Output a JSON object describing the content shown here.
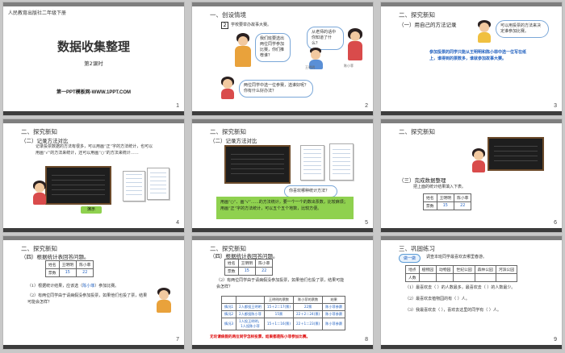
{
  "slides": [
    {
      "number": "1",
      "header": "人民教育出版社二年级下册",
      "title": "数据收集整理",
      "subtitle": "第2课时",
      "site": "第一PPT模板网-WWW.1PPT.COM"
    },
    {
      "number": "2",
      "section": "一、创设情境",
      "badge": "2",
      "caption": "学校要举办故事大赛。",
      "teacher_bubble": "我们班要选出两位同学参加比赛，你们推荐谁？",
      "girl_bubble": "从老师的话中你知道了什么？",
      "name_left": "王明明",
      "name_right": "陈小菲",
      "question_bubble": "两位同学中选一位参赛，选谁好呢？你有什么好办法？"
    },
    {
      "number": "3",
      "section": "二、探究新知",
      "sub": "（一）用自己的方法记录",
      "bubble": "可以用投票的方法来决定谁参加比赛。",
      "body": "参加投票的同学只能从王明明和陈小菲中选一位写在纸上，谁得到的票数多，谁就参加故事大赛。"
    },
    {
      "number": "4",
      "section": "二、探究新知",
      "sub": "（二）记录方法对比",
      "body": "记录投票数据的方法有很多，可以用画“正”字的方法统计，也可以用画“√”的方法来统计，还可以用画“○”的方法来统计……",
      "girl_bubble": "选票：",
      "button_label": "演示"
    },
    {
      "number": "5",
      "section": "二、探究新知",
      "sub": "（二）记录方法对比",
      "bubble": "你喜欢哪种统计方法？",
      "green": "用画“○”、画“√”……的方法统计，要一个一个的数出票数，比较麻烦；用画“正”字的方法统计，可以五个五个地数，比较方便。"
    },
    {
      "number": "6",
      "section": "二、探究新知",
      "sub": "（三）完成数据整理",
      "body": "把上面的统计结果填入下表。",
      "table_headers": [
        "姓名",
        "王明明",
        "陈小菲"
      ],
      "table_row_label": "票数",
      "table_values": [
        "15",
        "22"
      ]
    },
    {
      "number": "7",
      "section": "二、探究新知",
      "sub": "（四）根据统计表回答问题。",
      "table_headers": [
        "姓名",
        "王明明",
        "陈小菲"
      ],
      "table_row_label": "票数",
      "table_values": [
        "15",
        "22"
      ],
      "q1_prefix": "（1）根据统计结果，应该选（",
      "q1_answer": "陈小菲",
      "q1_suffix": "）参加比赛。",
      "q2": "（2）有两位同学由于请病假没参加投票，如果他们也投了票，结果可能会怎样？"
    },
    {
      "number": "8",
      "section": "二、探究新知",
      "sub": "（四）根据统计表回答问题。",
      "table_headers": [
        "姓名",
        "王明明",
        "陈小菲"
      ],
      "table_row_label": "票数",
      "table_values": [
        "15",
        "22"
      ],
      "q": "（2）有两位同学由于请病假没参加投票，如果他们也投了票，结果可能会怎样？",
      "case_headers": [
        "",
        "",
        "王明明的票数",
        "陈小菲的票数",
        "结果"
      ],
      "cases": [
        [
          "情况1",
          "2人都投王明明",
          "15＋2＝17(票)",
          "22票",
          "陈小菲参赛"
        ],
        [
          "情况2",
          "2人都投陈小菲",
          "15票",
          "22＋2＝24(票)",
          "陈小菲参赛"
        ],
        [
          "情况3",
          "1人投王明明，1人投陈小菲",
          "15＋1＝16(票)",
          "22＋1＝23(票)",
          "陈小菲参赛"
        ]
      ],
      "conclusion": "无论请病假的两位同学怎样投票，结果都是陈小菲参加比赛。"
    },
    {
      "number": "9",
      "section": "三、巩固练习",
      "tag": "做一做",
      "task": "调查本班同学最喜欢去哪里春游。",
      "table_headers": [
        "地点",
        "植物园",
        "动物园",
        "世纪公园",
        "森林公园",
        "河滨公园"
      ],
      "table_row_label": "人数",
      "q1": "（1）最喜欢去（   ）的人数最多，最喜欢去（   ）的人数最少。",
      "q2": "（2）最喜欢去植物园的有（   ）人。",
      "q3": "（3）我最喜欢去（   ），喜欢去这里的同学有（   ）人。"
    }
  ]
}
